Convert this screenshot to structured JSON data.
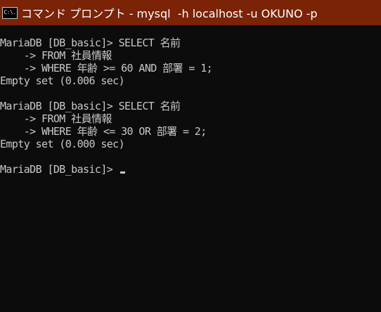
{
  "window": {
    "title": "コマンド プロンプト - mysql  -h localhost -u OKUNO -p",
    "icon_label": "C:\\.",
    "icon_name": "console-icon",
    "titlebar_color": "#7a2306"
  },
  "console": {
    "lines": [
      "MariaDB [DB_basic]> SELECT 名前",
      "    -> FROM 社員情報",
      "    -> WHERE 年齢 >= 60 AND 部署 = 1;",
      "Empty set (0.006 sec)",
      "",
      "MariaDB [DB_basic]> SELECT 名前",
      "    -> FROM 社員情報",
      "    -> WHERE 年齢 <= 30 OR 部署 = 2;",
      "Empty set (0.000 sec)",
      "",
      "MariaDB [DB_basic]> "
    ],
    "text_color": "#c8c8c8",
    "background": "#0c0c0c"
  }
}
